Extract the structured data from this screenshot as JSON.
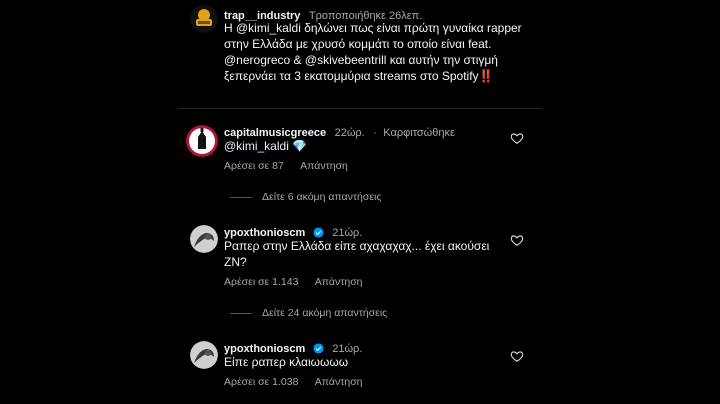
{
  "caption": {
    "username": "trap__industry",
    "edited_label": "Τροποποιήθηκε",
    "time": "26λεπ.",
    "text": "Η @kimi_kaldi δηλώνει πως είναι πρώτη γυναίκα rapper στην Ελλάδα με χρυσό κομμάτι το οποίο είναι feat. @nerogreco & @skivebeentrill και αυτήν την στιγμή ξεπερνάει τα 3 εκατομμύρια streams στο Spotify",
    "emoji": "‼️"
  },
  "comments": [
    {
      "username": "capitalmusicgreece",
      "time": "22ώρ.",
      "pinned_label": "Καρφιτσώθηκε",
      "text": "@kimi_kaldi",
      "emoji": "💎",
      "likes": "Αρέσει σε 87",
      "reply_label": "Απάντηση",
      "view_more": "Δείτε 6 ακόμη απαντήσεις"
    },
    {
      "username": "ypoxthonioscm",
      "time": "21ώρ.",
      "text": "Ραπερ στην Ελλάδα είπε αχαχαχαχ... έχει ακούσει ΖΝ?",
      "likes": "Αρέσει σε 1.143",
      "reply_label": "Απάντηση",
      "view_more": "Δείτε 24 ακόμη απαντήσεις"
    },
    {
      "username": "ypoxthonioscm",
      "time": "21ώρ.",
      "text": "Είπε ραπερ κλαιωωωω",
      "likes": "Αρέσει σε 1.038",
      "reply_label": "Απάντηση"
    }
  ],
  "colors": {
    "background": "#000000",
    "text": "#f5f5f5",
    "secondary": "#a8a8a8",
    "verified": "#0095f6"
  }
}
